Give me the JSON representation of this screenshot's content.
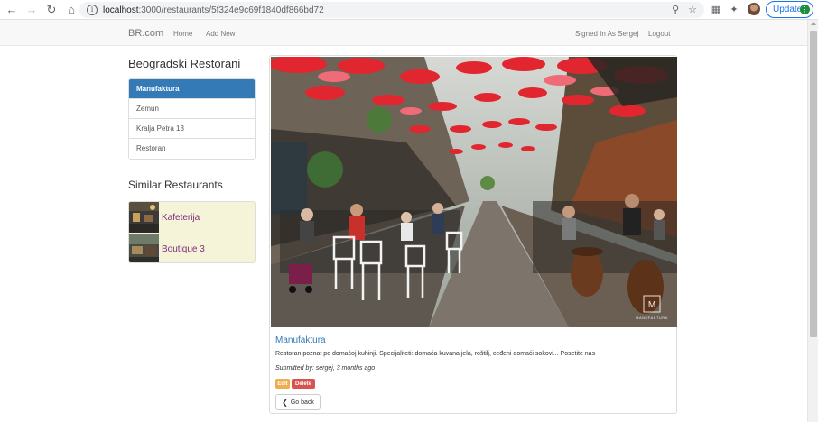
{
  "browser": {
    "url_host": "localhost",
    "url_path": ":3000/restaurants/5f324e9c69f1840df866bd72",
    "update_label": "Update"
  },
  "navbar": {
    "brand": "BR.com",
    "links": [
      "Home",
      "Add New"
    ],
    "signed_in": "Signed In As Sergej",
    "logout": "Logout"
  },
  "sidebar": {
    "title": "Beogradski Restorani",
    "items": [
      "Manufaktura",
      "Zemun",
      "Kralja Petra 13",
      "Restoran"
    ],
    "active_index": 0,
    "similar_title": "Similar Restaurants",
    "similar": [
      "Kafeterija",
      "Boutique 3"
    ]
  },
  "restaurant": {
    "name": "Manufaktura",
    "description": "Restoran poznat po domaćoj kuhinji. Specijaliteti: domaća kuvana jela, roštilj, ceđeni domaći sokovi... Posetite nas",
    "submitted": "Submitted by: sergej, 3 months ago",
    "photo_watermark": "MANUFAKTURA",
    "edit_label": "Edit",
    "delete_label": "Delete",
    "back_label": "Go back"
  },
  "colors": {
    "primary": "#337ab7",
    "warning": "#f0ad4e",
    "danger": "#d9534f",
    "similar_bg": "#f5f4d9"
  }
}
